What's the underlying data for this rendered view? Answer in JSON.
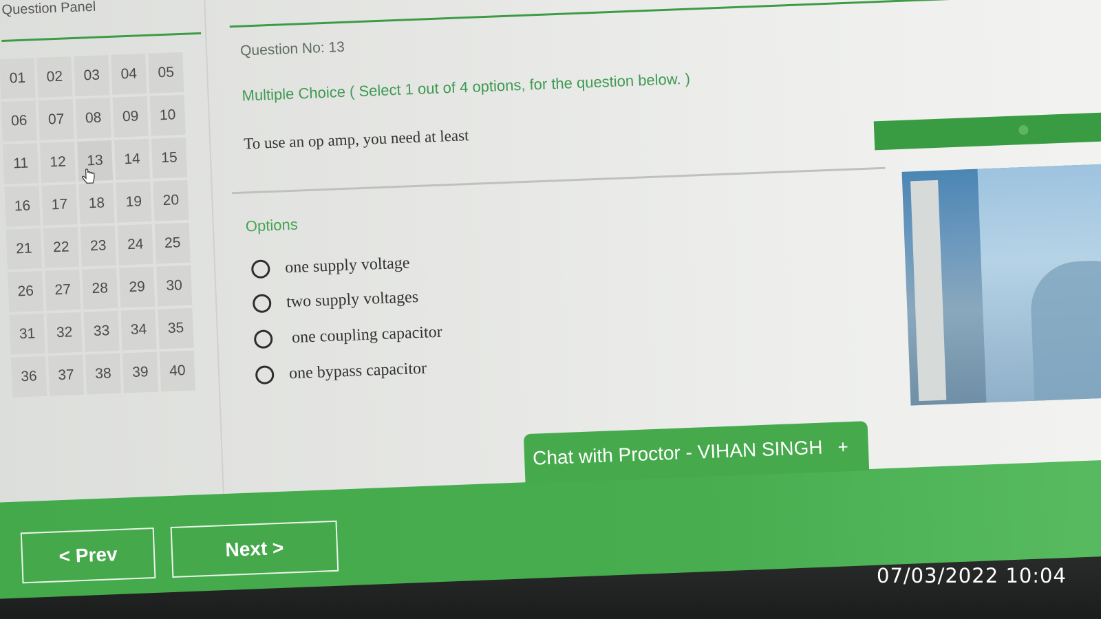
{
  "question_panel": {
    "title": "Question Panel",
    "numbers": [
      "01",
      "02",
      "03",
      "04",
      "05",
      "06",
      "07",
      "08",
      "09",
      "10",
      "11",
      "12",
      "13",
      "14",
      "15",
      "16",
      "17",
      "18",
      "19",
      "20",
      "21",
      "22",
      "23",
      "24",
      "25",
      "26",
      "27",
      "28",
      "29",
      "30",
      "31",
      "32",
      "33",
      "34",
      "35",
      "36",
      "37",
      "38",
      "39",
      "40"
    ],
    "current": "13"
  },
  "question": {
    "number_label": "Question No: 13",
    "type_label": "Multiple Choice ( Select 1 out of 4 options, for the question below. )",
    "text": "To use an op amp, you need at least"
  },
  "options": {
    "label": "Options",
    "items": [
      "one supply voltage",
      "two supply voltages",
      "one coupling capacitor",
      "one bypass capacitor"
    ]
  },
  "chat": {
    "label": "Chat with Proctor - VIHAN SINGH",
    "plus": "+"
  },
  "nav": {
    "prev_label": "< Prev",
    "next_label": "Next >"
  },
  "timestamp": "07/03/2022 10:04",
  "colors": {
    "accent": "#3d9b45",
    "bar": "#46aa4d"
  }
}
